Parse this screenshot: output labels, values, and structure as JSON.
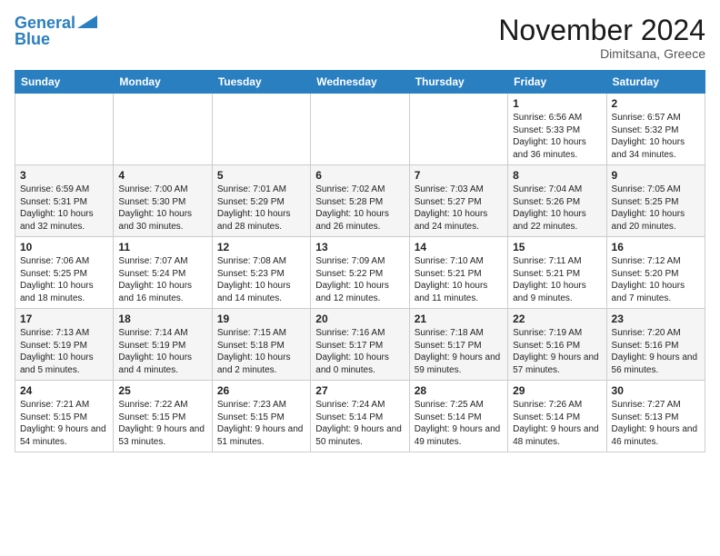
{
  "logo": {
    "line1": "General",
    "line2": "Blue"
  },
  "header": {
    "month": "November 2024",
    "location": "Dimitsana, Greece"
  },
  "weekdays": [
    "Sunday",
    "Monday",
    "Tuesday",
    "Wednesday",
    "Thursday",
    "Friday",
    "Saturday"
  ],
  "rows": [
    [
      {
        "day": "",
        "content": ""
      },
      {
        "day": "",
        "content": ""
      },
      {
        "day": "",
        "content": ""
      },
      {
        "day": "",
        "content": ""
      },
      {
        "day": "",
        "content": ""
      },
      {
        "day": "1",
        "content": "Sunrise: 6:56 AM\nSunset: 5:33 PM\nDaylight: 10 hours and 36 minutes."
      },
      {
        "day": "2",
        "content": "Sunrise: 6:57 AM\nSunset: 5:32 PM\nDaylight: 10 hours and 34 minutes."
      }
    ],
    [
      {
        "day": "3",
        "content": "Sunrise: 6:59 AM\nSunset: 5:31 PM\nDaylight: 10 hours and 32 minutes."
      },
      {
        "day": "4",
        "content": "Sunrise: 7:00 AM\nSunset: 5:30 PM\nDaylight: 10 hours and 30 minutes."
      },
      {
        "day": "5",
        "content": "Sunrise: 7:01 AM\nSunset: 5:29 PM\nDaylight: 10 hours and 28 minutes."
      },
      {
        "day": "6",
        "content": "Sunrise: 7:02 AM\nSunset: 5:28 PM\nDaylight: 10 hours and 26 minutes."
      },
      {
        "day": "7",
        "content": "Sunrise: 7:03 AM\nSunset: 5:27 PM\nDaylight: 10 hours and 24 minutes."
      },
      {
        "day": "8",
        "content": "Sunrise: 7:04 AM\nSunset: 5:26 PM\nDaylight: 10 hours and 22 minutes."
      },
      {
        "day": "9",
        "content": "Sunrise: 7:05 AM\nSunset: 5:25 PM\nDaylight: 10 hours and 20 minutes."
      }
    ],
    [
      {
        "day": "10",
        "content": "Sunrise: 7:06 AM\nSunset: 5:25 PM\nDaylight: 10 hours and 18 minutes."
      },
      {
        "day": "11",
        "content": "Sunrise: 7:07 AM\nSunset: 5:24 PM\nDaylight: 10 hours and 16 minutes."
      },
      {
        "day": "12",
        "content": "Sunrise: 7:08 AM\nSunset: 5:23 PM\nDaylight: 10 hours and 14 minutes."
      },
      {
        "day": "13",
        "content": "Sunrise: 7:09 AM\nSunset: 5:22 PM\nDaylight: 10 hours and 12 minutes."
      },
      {
        "day": "14",
        "content": "Sunrise: 7:10 AM\nSunset: 5:21 PM\nDaylight: 10 hours and 11 minutes."
      },
      {
        "day": "15",
        "content": "Sunrise: 7:11 AM\nSunset: 5:21 PM\nDaylight: 10 hours and 9 minutes."
      },
      {
        "day": "16",
        "content": "Sunrise: 7:12 AM\nSunset: 5:20 PM\nDaylight: 10 hours and 7 minutes."
      }
    ],
    [
      {
        "day": "17",
        "content": "Sunrise: 7:13 AM\nSunset: 5:19 PM\nDaylight: 10 hours and 5 minutes."
      },
      {
        "day": "18",
        "content": "Sunrise: 7:14 AM\nSunset: 5:19 PM\nDaylight: 10 hours and 4 minutes."
      },
      {
        "day": "19",
        "content": "Sunrise: 7:15 AM\nSunset: 5:18 PM\nDaylight: 10 hours and 2 minutes."
      },
      {
        "day": "20",
        "content": "Sunrise: 7:16 AM\nSunset: 5:17 PM\nDaylight: 10 hours and 0 minutes."
      },
      {
        "day": "21",
        "content": "Sunrise: 7:18 AM\nSunset: 5:17 PM\nDaylight: 9 hours and 59 minutes."
      },
      {
        "day": "22",
        "content": "Sunrise: 7:19 AM\nSunset: 5:16 PM\nDaylight: 9 hours and 57 minutes."
      },
      {
        "day": "23",
        "content": "Sunrise: 7:20 AM\nSunset: 5:16 PM\nDaylight: 9 hours and 56 minutes."
      }
    ],
    [
      {
        "day": "24",
        "content": "Sunrise: 7:21 AM\nSunset: 5:15 PM\nDaylight: 9 hours and 54 minutes."
      },
      {
        "day": "25",
        "content": "Sunrise: 7:22 AM\nSunset: 5:15 PM\nDaylight: 9 hours and 53 minutes."
      },
      {
        "day": "26",
        "content": "Sunrise: 7:23 AM\nSunset: 5:15 PM\nDaylight: 9 hours and 51 minutes."
      },
      {
        "day": "27",
        "content": "Sunrise: 7:24 AM\nSunset: 5:14 PM\nDaylight: 9 hours and 50 minutes."
      },
      {
        "day": "28",
        "content": "Sunrise: 7:25 AM\nSunset: 5:14 PM\nDaylight: 9 hours and 49 minutes."
      },
      {
        "day": "29",
        "content": "Sunrise: 7:26 AM\nSunset: 5:14 PM\nDaylight: 9 hours and 48 minutes."
      },
      {
        "day": "30",
        "content": "Sunrise: 7:27 AM\nSunset: 5:13 PM\nDaylight: 9 hours and 46 minutes."
      }
    ]
  ]
}
